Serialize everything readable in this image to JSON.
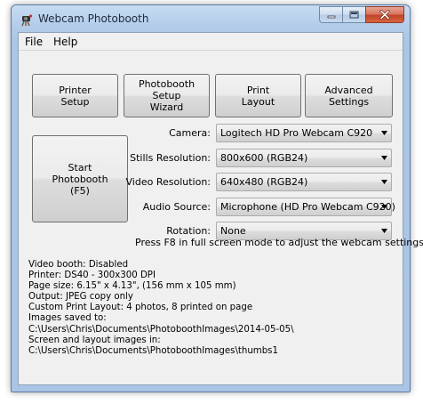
{
  "window": {
    "title": "Webcam Photobooth"
  },
  "menu": [
    "File",
    "Help"
  ],
  "buttons": {
    "printer_setup": "Printer\nSetup",
    "wizard": "Photobooth\nSetup\nWizard",
    "print_layout": "Print\nLayout",
    "advanced": "Advanced\nSettings",
    "start": "Start\nPhotobooth\n(F5)"
  },
  "fields": [
    {
      "label": "Camera:",
      "value": "Logitech HD Pro Webcam C920"
    },
    {
      "label": "Stills Resolution:",
      "value": "800x600 (RGB24)"
    },
    {
      "label": "Video Resolution:",
      "value": "640x480 (RGB24)"
    },
    {
      "label": "Audio Source:",
      "value": "Microphone (HD Pro Webcam C920)"
    },
    {
      "label": "Rotation:",
      "value": "None"
    }
  ],
  "hint": "Press F8 in full screen mode to adjust the webcam settings",
  "info": [
    "Video booth: Disabled",
    "Printer: DS40 - 300x300 DPI",
    "Page size: 6.15\" x 4.13\", (156 mm x 105 mm)",
    "Output: JPEG copy only",
    "Custom Print Layout: 4 photos, 8 printed on page",
    "Images saved to:",
    "C:\\Users\\Chris\\Documents\\PhotoboothImages\\2014-05-05\\",
    "Screen and layout images in:",
    "C:\\Users\\Chris\\Documents\\PhotoboothImages\\thumbs1"
  ]
}
